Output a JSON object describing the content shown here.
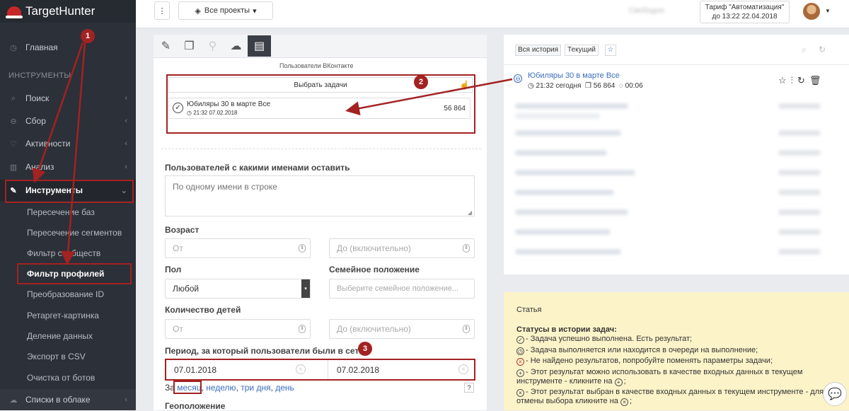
{
  "brand": {
    "name": "TargetHunter"
  },
  "sidebar": {
    "main": "Главная",
    "section": "ИНСТРУМЕНТЫ",
    "items": [
      "Поиск",
      "Сбор",
      "Активности",
      "Анализ",
      "Инструменты"
    ],
    "subitems": [
      "Пересечение баз",
      "Пересечение сегментов",
      "Фильтр сообществ",
      "Фильтр профилей",
      "Преобразование ID",
      "Ретаргет-картинка",
      "Деление данных",
      "Экспорт в CSV",
      "Очистка от ботов"
    ],
    "bottom": "Списки в облаке"
  },
  "topbar": {
    "menu_icon": "⋮",
    "projects": "Все проекты",
    "hidden_btn": "Свободно",
    "tariff_line1": "Тариф \"Автоматизация\"",
    "tariff_line2": "до 13:22 22.04.2018"
  },
  "form": {
    "section_title": "Пользователи ВКонтакте",
    "choose_tasks": "Выбрать задачи",
    "task": {
      "name": "Юбиляры 30 в марте Все",
      "time": "21:32 07.02.2018",
      "count": "56 864"
    },
    "names_label": "Пользователей с какими именами оставить",
    "names_placeholder": "По одному имени в строке",
    "age_label": "Возраст",
    "age_from": "От",
    "age_to": "До (включительно)",
    "sex_label": "Пол",
    "sex_value": "Любой",
    "family_label": "Семейное положение",
    "family_placeholder": "Выберите семейное положение...",
    "kids_label": "Количество детей",
    "kids_from": "От",
    "kids_to": "До (включительно)",
    "period_label": "Период, за который пользователи были в сети",
    "date_from": "07.01.2018",
    "date_to": "07.02.2018",
    "period_prefix": "За",
    "period_links": [
      "месяц",
      "неделю",
      "три дня",
      "день"
    ],
    "help": "?",
    "geo_label": "Геоположение"
  },
  "history": {
    "tabs": [
      "Вся история",
      "Текущий"
    ],
    "item": {
      "name": "Юбиляры 30 в марте Все",
      "time": "21:32 сегодня",
      "count": "56 864",
      "duration": "00:06"
    }
  },
  "info": {
    "link": "Статья",
    "title": "Статусы в истории задач:",
    "lines": [
      "- Задача успешно выполнена. Есть результат;",
      "- Задача выполняется или находится в очереди на выполнение;",
      "- Не найдено результатов, попробуйте поменять параметры задачи;",
      "- Этот результат можно использовать в качестве входных данных в текущем инструменте - кликните на",
      "- Этот результат выбран в качестве входных данных в текущем инструменте - для отмены выбора кликните на"
    ]
  },
  "annotations": [
    "1",
    "2",
    "3"
  ],
  "colors": {
    "accent": "#a32222",
    "sidebar": "#2c3038",
    "link": "#3b6dbf",
    "info_bg": "#fcf3c9"
  }
}
